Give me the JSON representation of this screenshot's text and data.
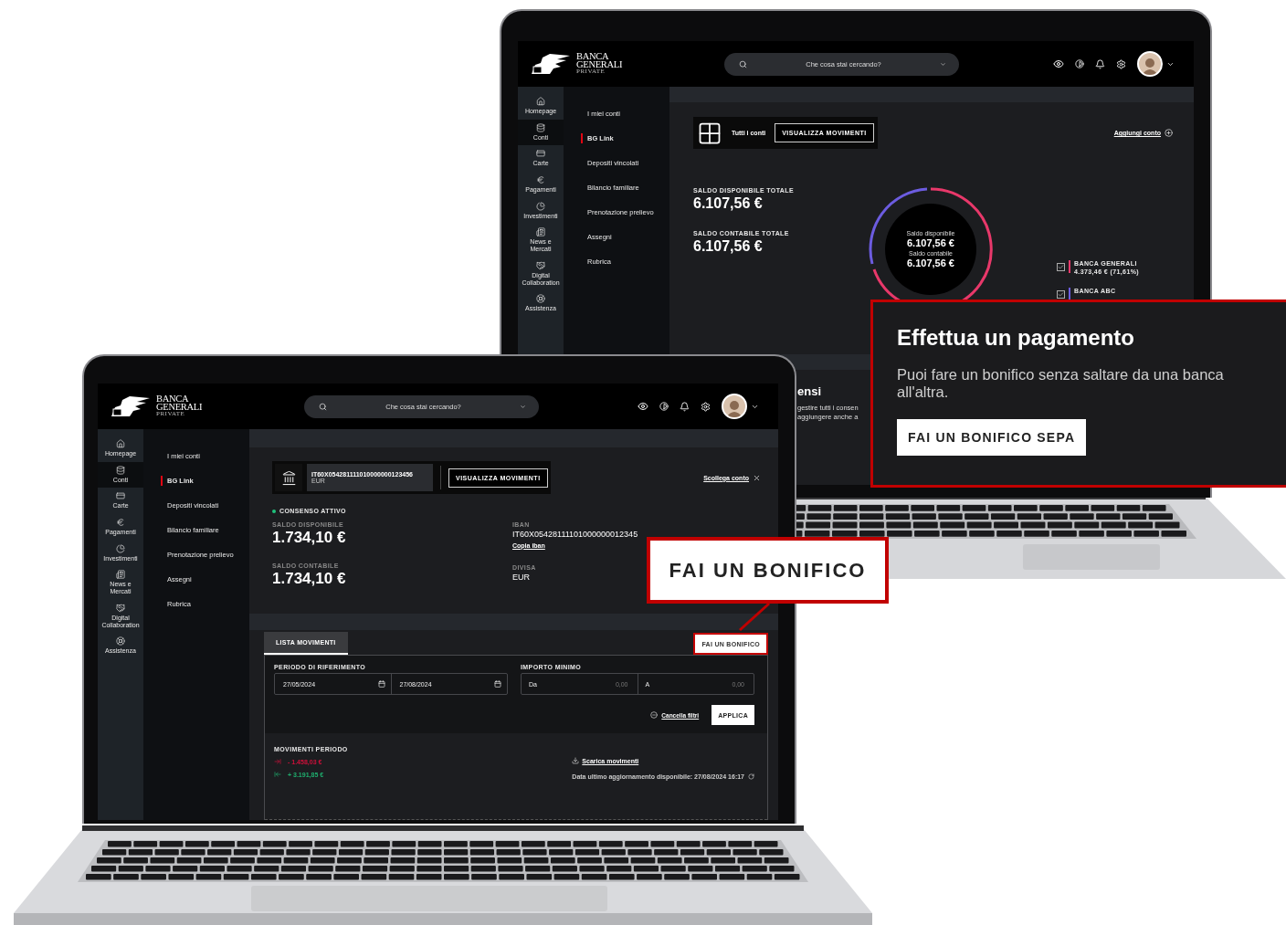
{
  "back_screen": {
    "logo": [
      "BANCA",
      "GENERALI",
      "PRIVATE"
    ],
    "search": {
      "placeholder": "Che cosa stai cercando?"
    },
    "rail": [
      {
        "label": "Homepage",
        "selected": false
      },
      {
        "label": "Conti",
        "selected": true
      },
      {
        "label": "Carte",
        "selected": false
      },
      {
        "label": "Pagamenti",
        "selected": false
      },
      {
        "label": "Investimenti",
        "selected": false
      },
      {
        "label": "News e Mercati",
        "selected": false
      },
      {
        "label": "Digital Collaboration",
        "selected": false
      },
      {
        "label": "Assistenza",
        "selected": false
      }
    ],
    "menu": [
      {
        "label": "I miei conti",
        "selected": false
      },
      {
        "label": "BG Link",
        "selected": true
      },
      {
        "label": "Depositi vincolati",
        "selected": false
      },
      {
        "label": "Bilancio familiare",
        "selected": false
      },
      {
        "label": "Prenotazione prelievo",
        "selected": false
      },
      {
        "label": "Assegni",
        "selected": false
      },
      {
        "label": "Rubrica",
        "selected": false
      }
    ],
    "summary": {
      "label": "Tutti i conti",
      "button": "VISUALIZZA MOVIMENTI",
      "link": "Aggiungi conto"
    },
    "balances": [
      {
        "label": "SALDO DISPONIBILE TOTALE",
        "amount": "6.107,56 €"
      },
      {
        "label": "SALDO CONTABILE TOTALE",
        "amount": "6.107,56 €"
      }
    ],
    "donut": [
      {
        "label": "Saldo disponibile",
        "amount": "6.107,56 €"
      },
      {
        "label": "Saldo contabile",
        "amount": "6.107,56 €"
      }
    ],
    "legend": [
      {
        "name": "BANCA GENERALI",
        "detail": "4.373,46 € (71,61%)",
        "color": "#e8386a",
        "checked": true
      },
      {
        "name": "BANCA ABC",
        "color": "#6c5ce0",
        "checked": true
      }
    ],
    "consents": {
      "title": "ensi",
      "lines": [
        "gestire tutti i consen",
        "aggiungere anche a"
      ]
    }
  },
  "front_screen": {
    "logo": [
      "BANCA",
      "GENERALI",
      "PRIVATE"
    ],
    "search": {
      "placeholder": "Che cosa stai cercando?"
    },
    "rail": [
      {
        "label": "Homepage",
        "selected": false
      },
      {
        "label": "Conti",
        "selected": true
      },
      {
        "label": "Carte",
        "selected": false
      },
      {
        "label": "Pagamenti",
        "selected": false
      },
      {
        "label": "Investimenti",
        "selected": false
      },
      {
        "label": "News e Mercati",
        "selected": false
      },
      {
        "label": "Digital Collaboration",
        "selected": false
      },
      {
        "label": "Assistenza",
        "selected": false
      }
    ],
    "menu": [
      {
        "label": "I miei conti",
        "selected": false
      },
      {
        "label": "BG Link",
        "selected": true
      },
      {
        "label": "Depositi vincolati",
        "selected": false
      },
      {
        "label": "Bilancio familiare",
        "selected": false
      },
      {
        "label": "Prenotazione prelievo",
        "selected": false
      },
      {
        "label": "Assegni",
        "selected": false
      },
      {
        "label": "Rubrica",
        "selected": false
      }
    ],
    "account": {
      "iban": "IT60X054281111010000000123456",
      "currency": "EUR",
      "button": "VISUALIZZA MOVIMENTI",
      "unlink": "Scollega conto"
    },
    "consent": {
      "label": "CONSENSO ATTIVO",
      "active": true
    },
    "details": [
      [
        {
          "label": "SALDO DISPONIBILE",
          "value": "1.734,10 €"
        },
        {
          "label": "SALDO CONTABILE",
          "value": "1.734,10 €"
        }
      ],
      [
        {
          "label": "IBAN",
          "value": "IT60X05428111101000000012345",
          "link": "Copia iban"
        },
        {
          "label": "DIVISA",
          "value": "EUR"
        }
      ]
    ],
    "tabs": [
      {
        "label": "LISTA MOVIMENTI",
        "selected": true
      }
    ],
    "transfer_button": "FAI UN BONIFICO",
    "filters": {
      "period": {
        "label": "PERIODO DI RIFERIMENTO",
        "from": "27/05/2024",
        "to": "27/08/2024"
      },
      "amount": {
        "label": "IMPORTO MINIMO",
        "from_label": "Da",
        "from_placeholder": "0,00",
        "to_label": "A",
        "to_placeholder": "0,00"
      },
      "clear": "Cancella filtri",
      "apply": "APPLICA"
    },
    "movements": {
      "title": "MOVIMENTI PERIODO",
      "items": [
        {
          "kind": "out",
          "amount": "- 1.458,03 €"
        },
        {
          "kind": "in",
          "amount": "+ 3.191,85 €"
        }
      ],
      "download": "Scarica movimenti",
      "updated": "Data ultimo aggiornamento disponibile: 27/08/2024 16:17"
    }
  },
  "callout": {
    "label": "FAI UN BONIFICO"
  },
  "popup": {
    "title": "Effettua un pagamento",
    "text": "Puoi fare un bonifico senza saltare da una banca all'altra.",
    "button": "FAI UN BONIFICO SEPA"
  }
}
